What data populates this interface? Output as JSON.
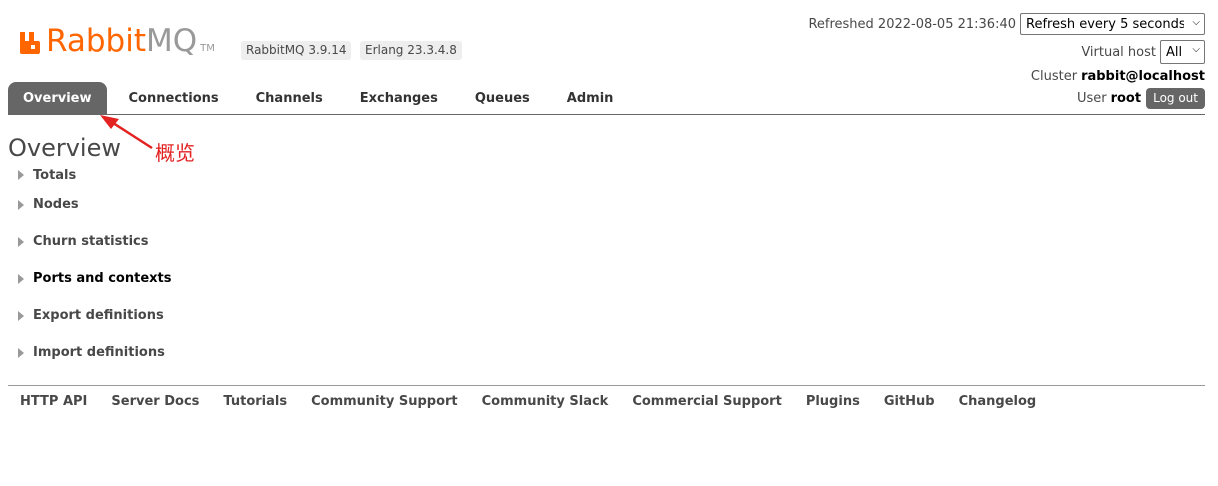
{
  "logo": {
    "brand": "Rabbit",
    "brand_suffix": "MQ",
    "tm": "TM"
  },
  "versions": {
    "rabbitmq": "RabbitMQ 3.9.14",
    "erlang": "Erlang 23.3.4.8"
  },
  "header": {
    "refreshed_label": "Refreshed 2022-08-05 21:36:40",
    "refresh_select": "Refresh every 5 seconds",
    "vhost_label": "Virtual host",
    "vhost_select": "All",
    "cluster_label": "Cluster",
    "cluster_name": "rabbit@localhost",
    "user_label": "User",
    "user_name": "root",
    "logout_label": "Log out"
  },
  "tabs": [
    {
      "label": "Overview",
      "active": true
    },
    {
      "label": "Connections"
    },
    {
      "label": "Channels"
    },
    {
      "label": "Exchanges"
    },
    {
      "label": "Queues"
    },
    {
      "label": "Admin"
    }
  ],
  "annotation": {
    "text": "概览",
    "color": "#e32222"
  },
  "main": {
    "title": "Overview",
    "sections": [
      {
        "label": "Totals"
      },
      {
        "label": "Nodes"
      },
      {
        "label": "Churn statistics"
      },
      {
        "label": "Ports and contexts"
      },
      {
        "label": "Export definitions"
      },
      {
        "label": "Import definitions"
      }
    ]
  },
  "footer": {
    "links": [
      {
        "label": "HTTP API"
      },
      {
        "label": "Server Docs"
      },
      {
        "label": "Tutorials"
      },
      {
        "label": "Community Support"
      },
      {
        "label": "Community Slack"
      },
      {
        "label": "Commercial Support"
      },
      {
        "label": "Plugins"
      },
      {
        "label": "GitHub"
      },
      {
        "label": "Changelog"
      }
    ]
  },
  "colors": {
    "brand_orange": "#ff6600",
    "tab_active": "#666666",
    "text": "#484848"
  }
}
